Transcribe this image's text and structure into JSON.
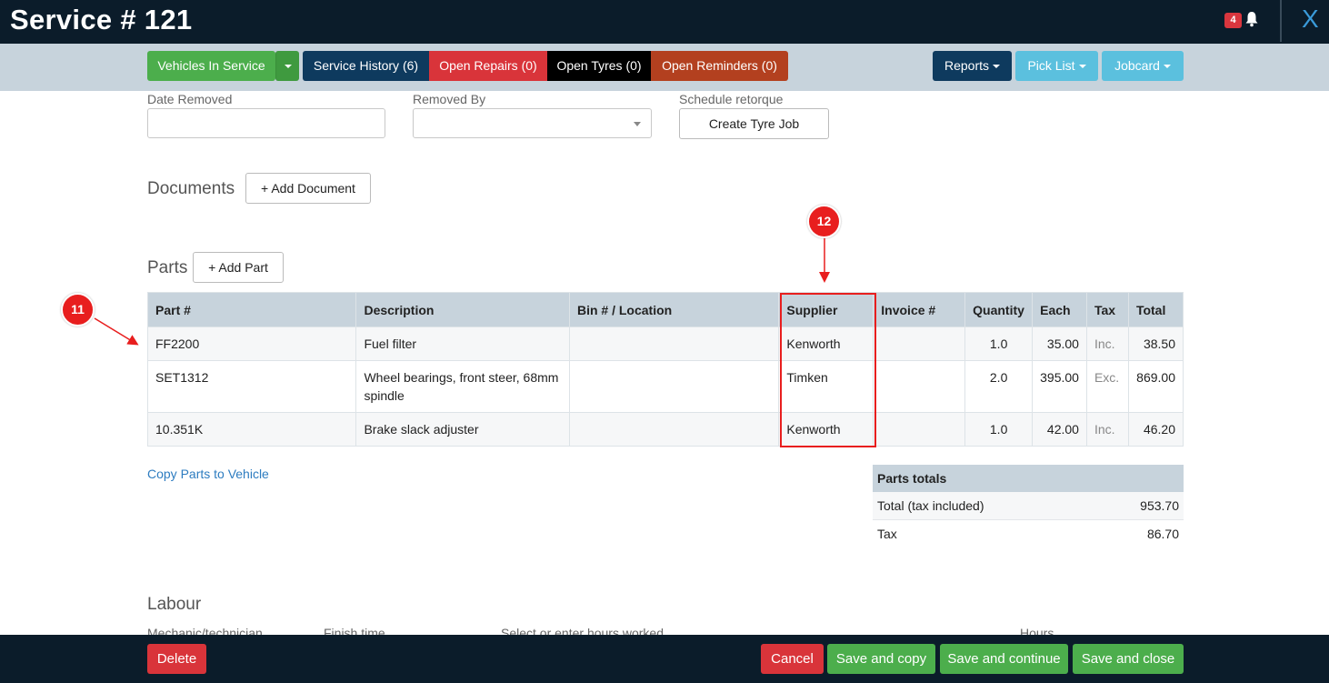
{
  "header": {
    "title": "Service # 121",
    "notification_count": "4",
    "close_label": "X"
  },
  "tabs": {
    "vehicles_in_service": "Vehicles In Service",
    "service_history": "Service History (6)",
    "open_repairs": "Open Repairs (0)",
    "open_tyres": "Open Tyres (0)",
    "open_reminders": "Open Reminders (0)",
    "reports": "Reports",
    "pick_list": "Pick List",
    "jobcard": "Jobcard"
  },
  "tyre_form": {
    "date_removed_label": "Date Removed",
    "date_removed_value": "",
    "removed_by_label": "Removed By",
    "removed_by_value": "",
    "schedule_label": "Schedule retorque",
    "create_tyre_job": "Create Tyre Job"
  },
  "documents": {
    "title": "Documents",
    "add_label": "+  Add Document"
  },
  "parts": {
    "title": "Parts",
    "add_label": "+  Add Part",
    "columns": [
      "Part #",
      "Description",
      "Bin # / Location",
      "Supplier",
      "Invoice #",
      "Quantity",
      "Each",
      "Tax",
      "Total"
    ],
    "rows": [
      {
        "part": "FF2200",
        "description": "Fuel filter",
        "bin": "",
        "supplier": "Kenworth",
        "invoice": "",
        "quantity": "1.0",
        "each": "35.00",
        "tax": "Inc.",
        "total": "38.50"
      },
      {
        "part": "SET1312",
        "description": "Wheel bearings, front steer, 68mm spindle",
        "bin": "",
        "supplier": "Timken",
        "invoice": "",
        "quantity": "2.0",
        "each": "395.00",
        "tax": "Exc.",
        "total": "869.00"
      },
      {
        "part": "10.351K",
        "description": "Brake slack adjuster",
        "bin": "",
        "supplier": "Kenworth",
        "invoice": "",
        "quantity": "1.0",
        "each": "42.00",
        "tax": "Inc.",
        "total": "46.20"
      }
    ],
    "copy_link": "Copy Parts to Vehicle"
  },
  "totals": {
    "title": "Parts totals",
    "total_label": "Total (tax included)",
    "total_value": "953.70",
    "tax_label": "Tax",
    "tax_value": "86.70"
  },
  "labour": {
    "title": "Labour",
    "mechanic_label": "Mechanic/technician",
    "finish_label": "Finish time",
    "hours_select_label": "Select or enter hours worked",
    "hours_label": "Hours"
  },
  "footer": {
    "delete": "Delete",
    "cancel": "Cancel",
    "save_copy": "Save and copy",
    "save_continue": "Save and continue",
    "save_close": "Save and close"
  },
  "annotations": {
    "callout_11": "11",
    "callout_12": "12"
  },
  "colors": {
    "header_bg": "#0b1c2a",
    "tabbar_bg": "#c7d3dc",
    "green": "#4cae4c",
    "navy": "#0e3a5e",
    "red": "#d9343a",
    "rust": "#b3401f",
    "lightblue": "#5bc0de",
    "annotation_red": "#e81e1e"
  }
}
